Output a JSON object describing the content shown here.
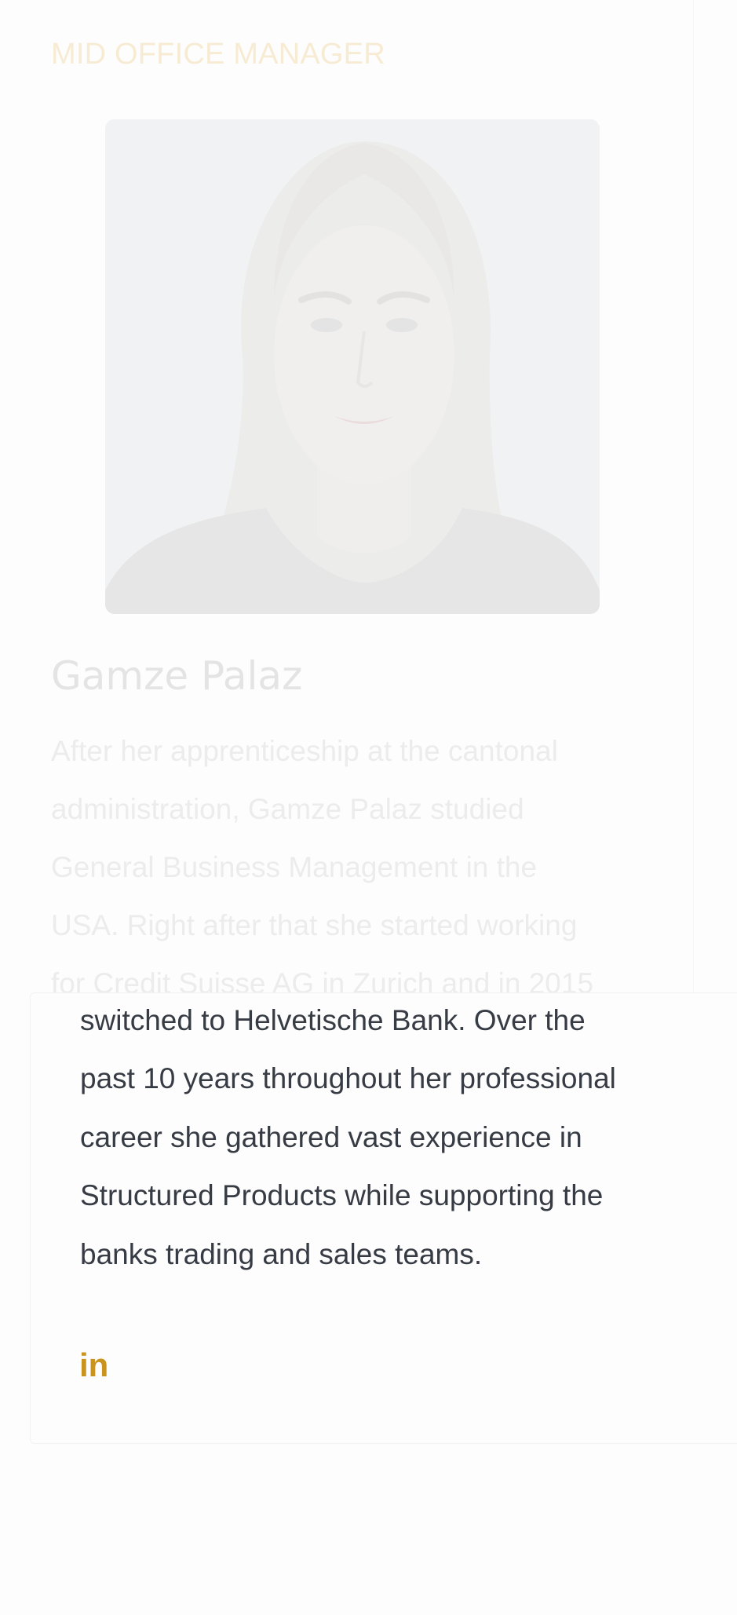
{
  "profile": {
    "role": "MID OFFICE MANAGER",
    "name": "Gamze Palaz",
    "bio_line_1": "After her apprenticeship at the cantonal",
    "bio_line_2": "administration, Gamze Palaz studied",
    "bio_line_3": "General Business Management in the",
    "bio_line_4": "USA. Right after that she started working",
    "bio_line_5": "for Credit Suisse AG in Zurich and in 2015",
    "bio_line_6": "switched to Helvetische Bank. Over the",
    "bio_line_7": "past 10 years throughout her professional",
    "bio_line_8": "career she gathered vast experience in",
    "bio_line_9": "Structured Products while supporting the",
    "bio_line_10": "banks trading and sales teams.",
    "linkedin_label": "in"
  },
  "colors": {
    "accent": "#c9931d",
    "role_faded": "#f7ecd3",
    "text_dark": "#363b44",
    "text_faded": "#ececec"
  },
  "icons": {
    "linkedin": "linkedin-icon"
  }
}
